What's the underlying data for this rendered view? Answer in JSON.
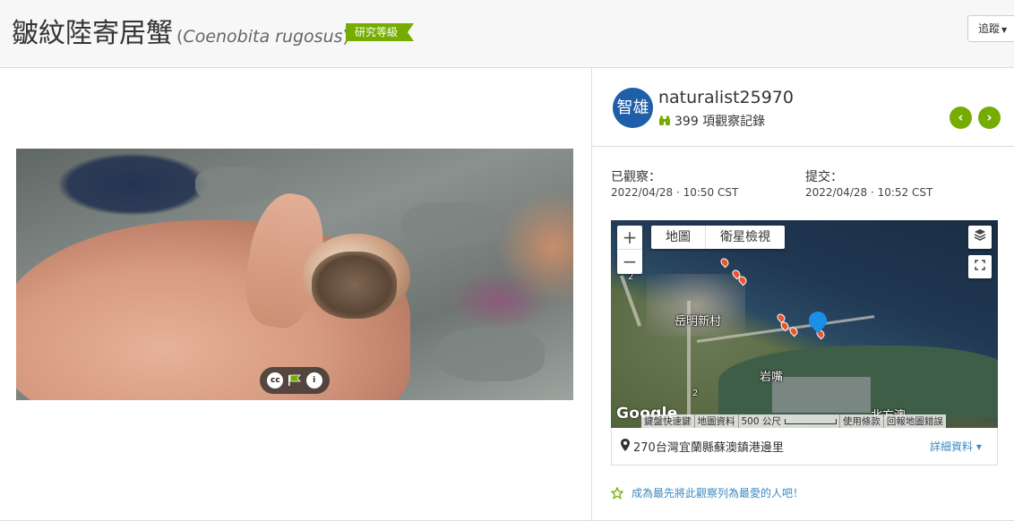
{
  "header": {
    "common_name": "皺紋陸寄居蟹",
    "sci_open": "(",
    "sci_name": "Coenobita rugosus",
    "sci_close": ")",
    "quality_grade": "研究等級",
    "follow_label": "追蹤",
    "follow_caret": "▼"
  },
  "user": {
    "avatar_text": "智雄",
    "name": "naturalist25970",
    "observations": "399 項觀察記錄"
  },
  "navigation": {
    "prev_icon": "chevron-left-icon",
    "next_icon": "chevron-right-icon",
    "prev_glyph": "‹",
    "next_glyph": "›"
  },
  "photo": {
    "controls": {
      "license_label": "cc",
      "flag_icon": "flag-icon",
      "info_label": "i"
    }
  },
  "details": {
    "observed_label": "已觀察：",
    "observed_value": "2022/04/28 · 10:50 CST",
    "submitted_label": "提交：",
    "submitted_value": "2022/04/28 · 10:52 CST"
  },
  "map": {
    "zoom_in": "+",
    "zoom_out": "−",
    "type_map": "地圖",
    "type_satellite": "衛星檢視",
    "label_village": "岳明新村",
    "label_aoa": "岩嘴",
    "label_north": "北方澳",
    "road_2a": "2",
    "road_2b": "2",
    "google": "Google",
    "attribution": {
      "shortcuts": "鍵盤快速鍵",
      "map_data": "地圖資料",
      "scale": "500 公尺",
      "terms": "使用條款",
      "report": "回報地圖錯誤"
    }
  },
  "location": {
    "text": "270台灣宜蘭縣蘇澳鎮港邊里",
    "more": "詳細資料 ▾"
  },
  "favorite": {
    "text": "成為最先將此觀察列為最愛的人吧！"
  },
  "colors": {
    "brand_green": "#74ac00",
    "link_blue": "#3b8bc2",
    "avatar_blue": "#1f5ea8"
  }
}
